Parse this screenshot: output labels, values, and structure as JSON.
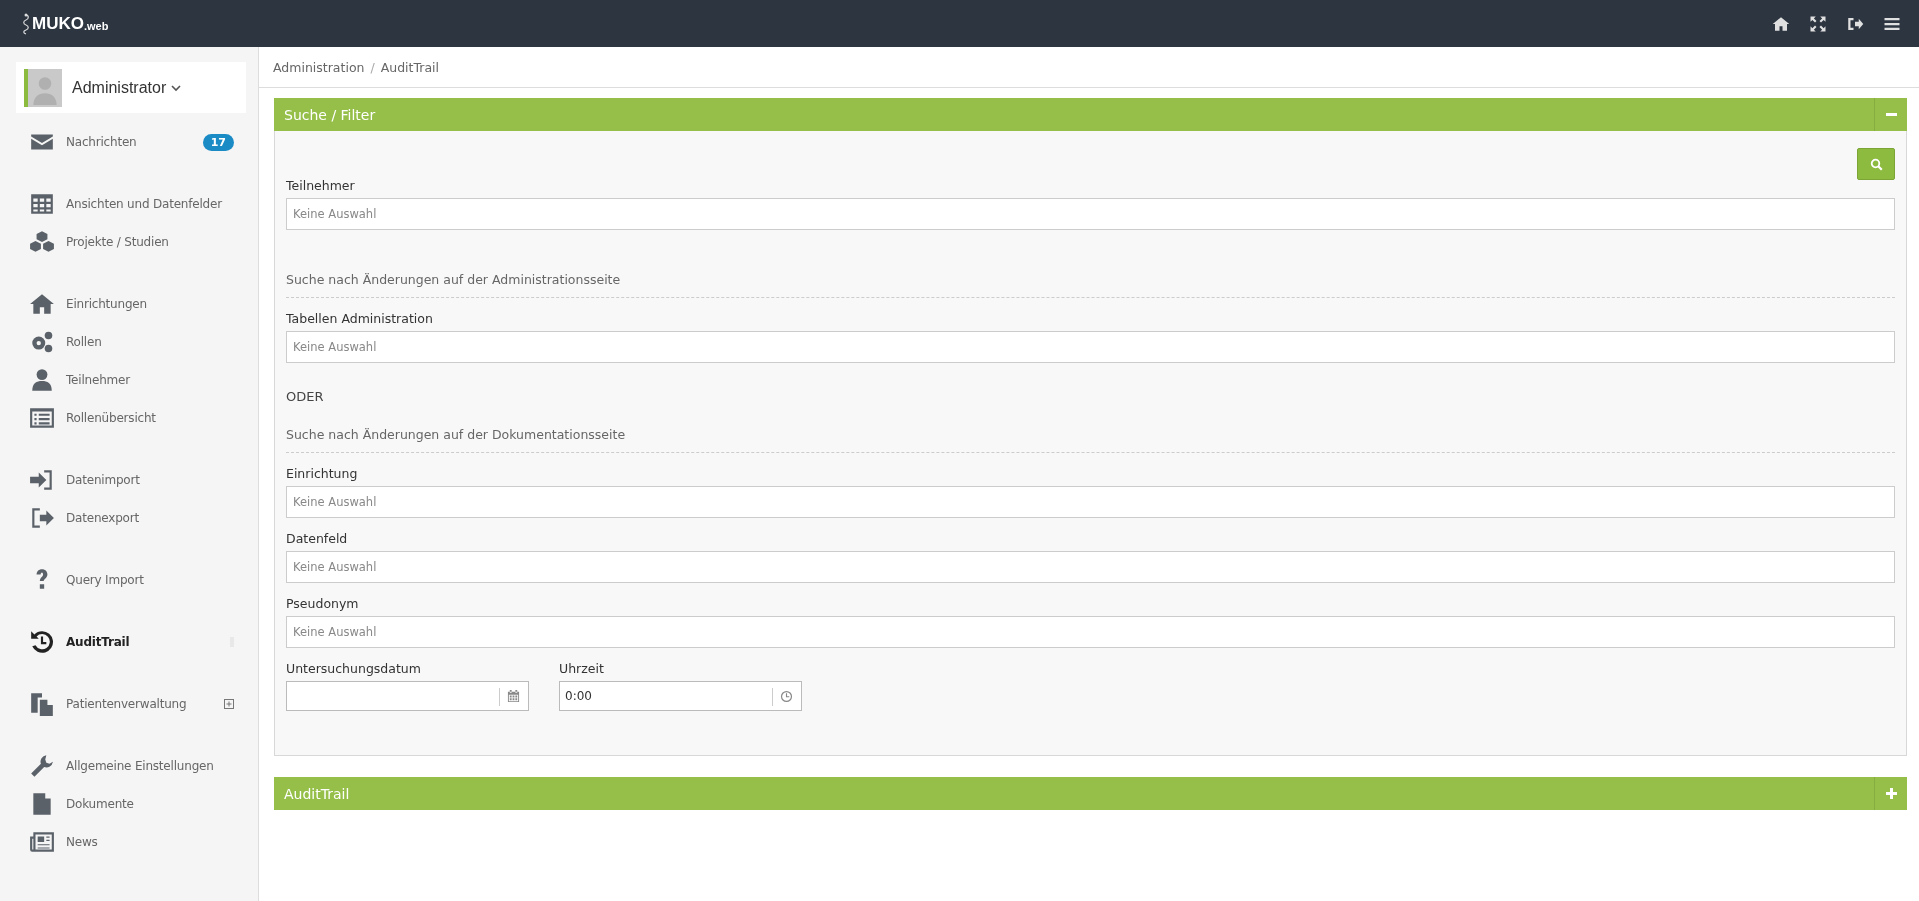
{
  "topbar": {
    "logo": "MUKO",
    "logo_suffix": ".web"
  },
  "user": {
    "name": "Administrator"
  },
  "sidebar": {
    "groups": [
      {
        "items": [
          {
            "label": "Nachrichten",
            "selected": false,
            "badge": "17"
          }
        ]
      },
      {
        "items": [
          {
            "label": "Ansichten und Datenfelder",
            "selected": false
          },
          {
            "label": "Projekte / Studien",
            "selected": false
          }
        ]
      },
      {
        "items": [
          {
            "label": "Einrichtungen",
            "selected": false
          },
          {
            "label": "Rollen",
            "selected": false
          },
          {
            "label": "Teilnehmer",
            "selected": false
          },
          {
            "label": "Rollenübersicht",
            "selected": false
          }
        ]
      },
      {
        "items": [
          {
            "label": "Datenimport",
            "selected": false
          },
          {
            "label": "Datenexport",
            "selected": false
          }
        ]
      },
      {
        "items": [
          {
            "label": "Query Import",
            "selected": false
          }
        ]
      },
      {
        "items": [
          {
            "label": "AuditTrail",
            "selected": true
          }
        ]
      },
      {
        "items": [
          {
            "label": "Patientenverwaltung",
            "selected": false,
            "expanded": false
          }
        ]
      },
      {
        "items": [
          {
            "label": "Allgemeine Einstellungen",
            "selected": false
          },
          {
            "label": "Dokumente",
            "selected": false
          },
          {
            "label": "News",
            "selected": false
          }
        ]
      }
    ]
  },
  "breadcrumb": [
    "Administration",
    "AuditTrail"
  ],
  "breadcrumb_separator": "/",
  "panels": [
    {
      "title": "Suche / Filter",
      "expanded": true,
      "fields": [
        {
          "kind": "select",
          "label": "Teilnehmer",
          "placeholder": "Keine Auswahl"
        },
        {
          "kind": "heading",
          "text": "Suche nach Änderungen auf der Administrationsseite"
        },
        {
          "kind": "select",
          "label": "Tabellen Administration",
          "placeholder": "Keine Auswahl"
        },
        {
          "kind": "text",
          "text": "ODER"
        },
        {
          "kind": "heading",
          "text": "Suche nach Änderungen auf der Dokumentationsseite"
        },
        {
          "kind": "select",
          "label": "Einrichtung",
          "placeholder": "Keine Auswahl"
        },
        {
          "kind": "select",
          "label": "Datenfeld",
          "placeholder": "Keine Auswahl"
        },
        {
          "kind": "select",
          "label": "Pseudonym",
          "placeholder": "Keine Auswahl"
        },
        {
          "kind": "row",
          "fields": [
            {
              "kind": "date",
              "label": "Untersuchungsdatum"
            },
            {
              "kind": "time",
              "label": "Uhrzeit",
              "value": "0:00"
            }
          ]
        }
      ]
    },
    {
      "title": "AuditTrail",
      "expanded": false
    }
  ]
}
